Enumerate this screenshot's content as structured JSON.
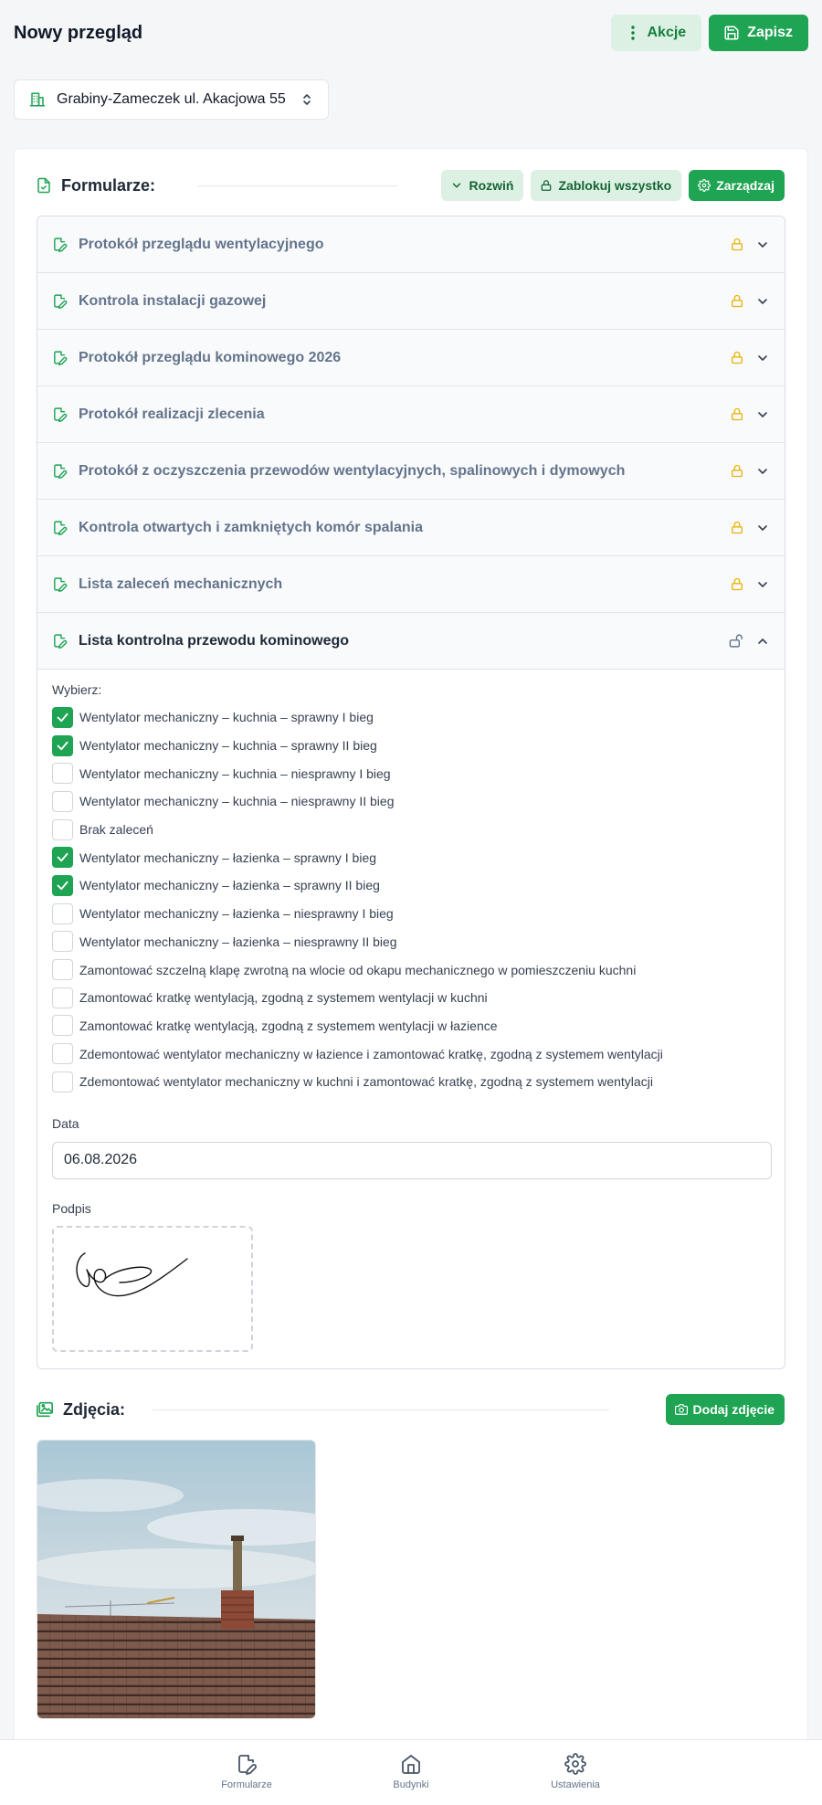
{
  "header": {
    "title": "Nowy przegląd",
    "actions_label": "Akcje",
    "save_label": "Zapisz"
  },
  "building": {
    "selected": "Grabiny-Zameczek ul. Akacjowa 55"
  },
  "forms_section": {
    "title": "Formularze:",
    "expand_label": "Rozwiń",
    "lock_all_label": "Zablokuj wszystko",
    "manage_label": "Zarządzaj",
    "items": [
      {
        "name": "Protokół przeglądu wentylacyjnego",
        "locked": true
      },
      {
        "name": "Kontrola instalacji gazowej",
        "locked": true
      },
      {
        "name": "Protokół przeglądu kominowego 2026",
        "locked": true
      },
      {
        "name": "Protokół realizacji zlecenia",
        "locked": true
      },
      {
        "name": "Protokół z oczyszczenia przewodów wentylacyjnych, spalinowych i dymowych",
        "locked": true
      },
      {
        "name": "Kontrola otwartych i zamkniętych komór spalania",
        "locked": true
      },
      {
        "name": "Lista zaleceń mechanicznych",
        "locked": true
      },
      {
        "name": "Lista kontrolna przewodu kominowego",
        "locked": false
      }
    ]
  },
  "open_form": {
    "choose_label": "Wybierz:",
    "checkboxes": [
      {
        "label": "Wentylator mechaniczny – kuchnia – sprawny I bieg",
        "checked": true
      },
      {
        "label": "Wentylator mechaniczny – kuchnia – sprawny II bieg",
        "checked": true
      },
      {
        "label": "Wentylator mechaniczny – kuchnia – niesprawny I bieg",
        "checked": false
      },
      {
        "label": "Wentylator mechaniczny – kuchnia – niesprawny II bieg",
        "checked": false
      },
      {
        "label": "Brak zaleceń",
        "checked": false
      },
      {
        "label": "Wentylator mechaniczny – łazienka – sprawny I bieg",
        "checked": true
      },
      {
        "label": "Wentylator mechaniczny – łazienka – sprawny II bieg",
        "checked": true
      },
      {
        "label": "Wentylator mechaniczny – łazienka – niesprawny I bieg",
        "checked": false
      },
      {
        "label": "Wentylator mechaniczny – łazienka – niesprawny II bieg",
        "checked": false
      },
      {
        "label": "Zamontować szczelną klapę zwrotną na wlocie od okapu mechanicznego w pomieszczeniu kuchni",
        "checked": false
      },
      {
        "label": "Zamontować kratkę wentylacją, zgodną z systemem wentylacji w kuchni",
        "checked": false
      },
      {
        "label": "Zamontować kratkę wentylacją, zgodną z systemem wentylacji w łazience",
        "checked": false
      },
      {
        "label": "Zdemontować wentylator mechaniczny w łazience i zamontować kratkę, zgodną z systemem wentylacji",
        "checked": false
      },
      {
        "label": "Zdemontować wentylator mechaniczny w kuchni i zamontować kratkę, zgodną z systemem wentylacji",
        "checked": false
      }
    ],
    "date_label": "Data",
    "date_value": "06.08.2026",
    "signature_label": "Podpis"
  },
  "photos_section": {
    "title": "Zdjęcia:",
    "add_label": "Dodaj zdjęcie"
  },
  "bottom_nav": {
    "items": [
      {
        "label": "Formularze",
        "icon": "form-icon"
      },
      {
        "label": "Budynki",
        "icon": "home-icon"
      },
      {
        "label": "Ustawienia",
        "icon": "gear-icon"
      }
    ]
  },
  "colors": {
    "accent": "#1ea453",
    "accent_light": "#dcf1e3",
    "lock": "#eab308"
  }
}
